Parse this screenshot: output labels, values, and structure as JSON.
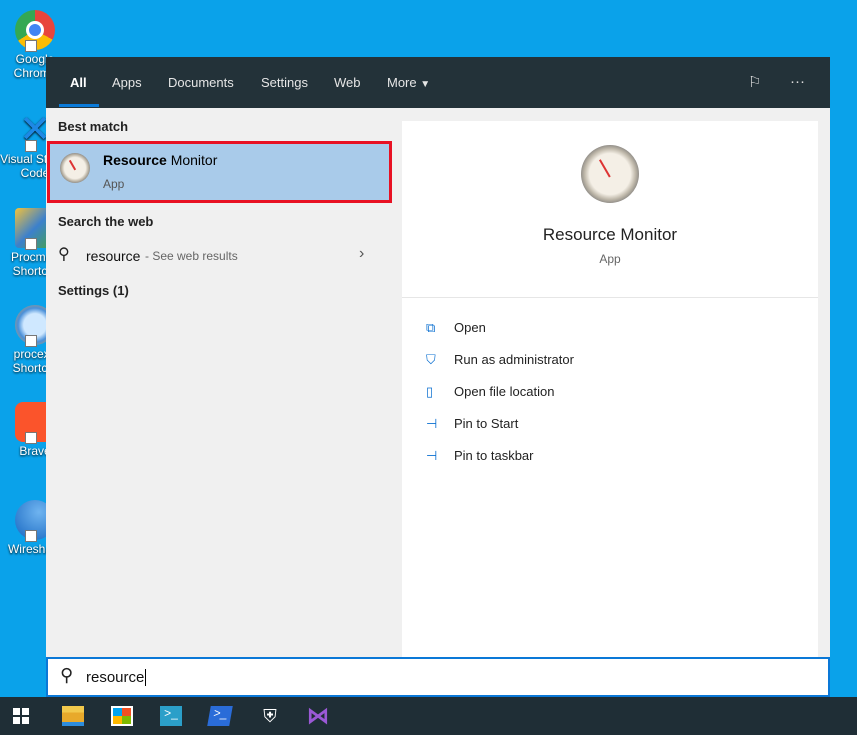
{
  "desktop": {
    "icons": [
      {
        "label": "Google Chrome",
        "color": "#e8453c"
      },
      {
        "label": "Visual Studio Code",
        "color": "#1e88e5"
      },
      {
        "label": "Procmon Shortcut",
        "color": "#3b6fc4"
      },
      {
        "label": "procexp Shortcut",
        "color": "#4a90d9"
      },
      {
        "label": "Brave",
        "color": "#fb542b"
      },
      {
        "label": "Wireshark",
        "color": "#1679c9"
      }
    ]
  },
  "tabs": [
    "All",
    "Apps",
    "Documents",
    "Settings",
    "Web",
    "More"
  ],
  "header_icons": [
    "feedback-icon",
    "more-options-icon"
  ],
  "left": {
    "best_match_heading": "Best match",
    "best": {
      "name_bold": "Resource",
      "name_rest": " Monitor",
      "type": "App"
    },
    "web_heading": "Search the web",
    "web": {
      "query": "resource",
      "suffix": " - See web results"
    },
    "settings_heading": "Settings (1)"
  },
  "detail": {
    "name": "Resource Monitor",
    "type": "App",
    "actions": [
      {
        "label": "Open",
        "icon": "open-icon"
      },
      {
        "label": "Run as administrator",
        "icon": "run-as-admin-icon"
      },
      {
        "label": "Open file location",
        "icon": "file-location-icon"
      },
      {
        "label": "Pin to Start",
        "icon": "pin-icon"
      },
      {
        "label": "Pin to taskbar",
        "icon": "pin-icon"
      }
    ]
  },
  "search": {
    "value": "resource"
  },
  "taskbar": [
    "start",
    "file-explorer",
    "store",
    "powershell-ise",
    "powershell",
    "security",
    "visual-studio"
  ]
}
